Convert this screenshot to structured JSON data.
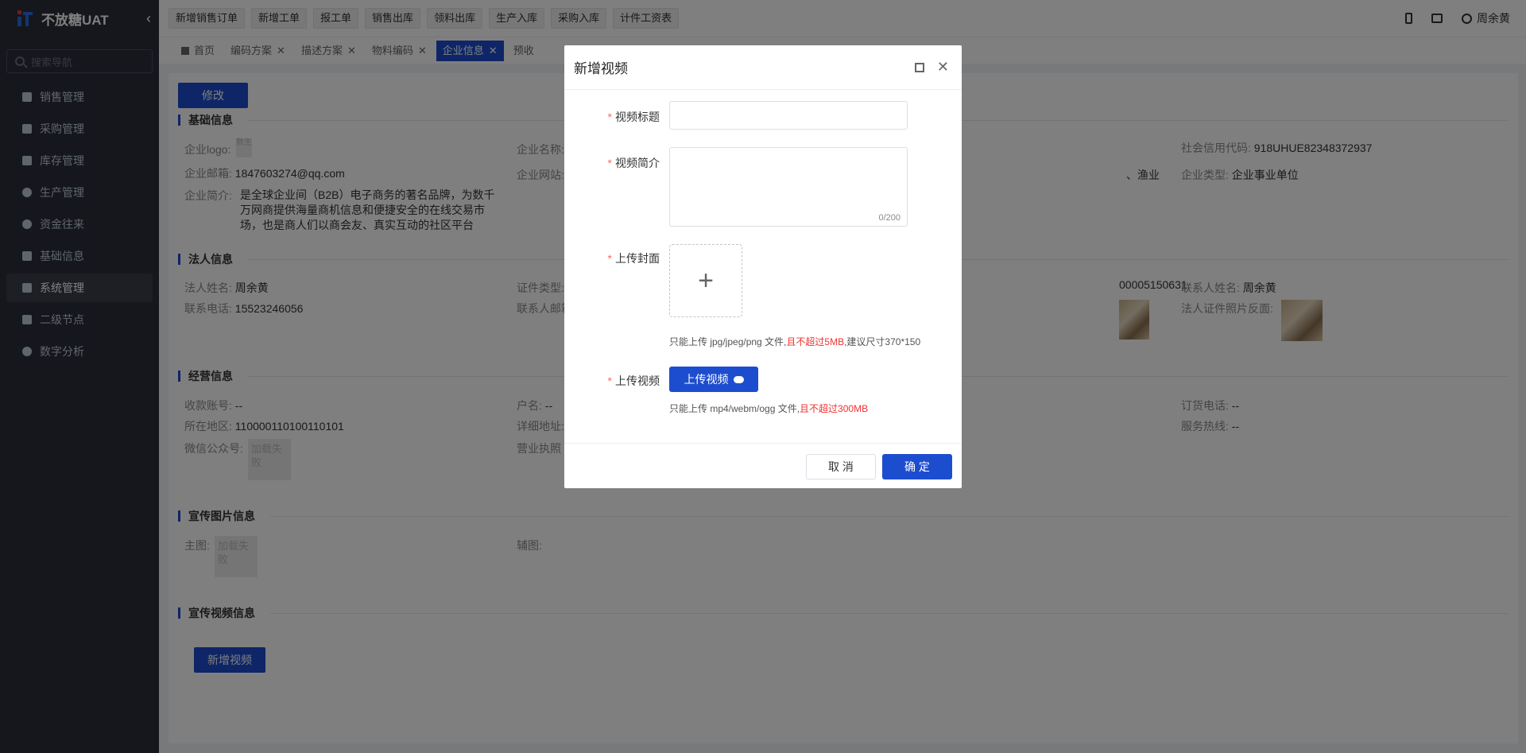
{
  "app": {
    "title": "不放糖UAT"
  },
  "sidebar": {
    "search_placeholder": "搜索导航",
    "items": [
      {
        "label": "销售管理",
        "icon": "tag-icon"
      },
      {
        "label": "采购管理",
        "icon": "cart-icon"
      },
      {
        "label": "库存管理",
        "icon": "box-icon"
      },
      {
        "label": "生产管理",
        "icon": "factory-icon"
      },
      {
        "label": "资金往来",
        "icon": "money-icon"
      },
      {
        "label": "基础信息",
        "icon": "info-icon"
      },
      {
        "label": "系统管理",
        "icon": "grid-icon"
      },
      {
        "label": "二级节点",
        "icon": "doc-icon"
      },
      {
        "label": "数字分析",
        "icon": "pie-icon"
      }
    ]
  },
  "topbar": {
    "quick_buttons": [
      "新增销售订单",
      "新增工单",
      "报工单",
      "销售出库",
      "领料出库",
      "生产入库",
      "采购入库",
      "计件工资表"
    ],
    "user": "周余黄"
  },
  "tabs": [
    {
      "label": "首页"
    },
    {
      "label": "编码方案"
    },
    {
      "label": "描述方案"
    },
    {
      "label": "物料编码"
    },
    {
      "label": "企业信息"
    },
    {
      "label": "预收"
    }
  ],
  "page": {
    "edit_button": "修改",
    "sections": {
      "basic": "基础信息",
      "legal": "法人信息",
      "business": "经营信息",
      "promo_images": "宣传图片信息",
      "promo_videos": "宣传视频信息"
    },
    "basic": {
      "logo_label": "企业logo:",
      "logo_thumb": "数生",
      "name_label": "企业名称:",
      "credit_label": "社会信用代码:",
      "credit_value": "918UHUE82348372937",
      "email_label": "企业邮箱:",
      "email_value": "1847603274@qq.com",
      "site_label": "企业网站:",
      "industry_tail": "、渔业",
      "type_label": "企业类型:",
      "type_value": "企业事业单位",
      "intro_label": "企业简介:",
      "intro_value": "是全球企业间（B2B）电子商务的著名品牌，为数千万网商提供海量商机信息和便捷安全的在线交易市场，也是商人们以商会友、真实互动的社区平台"
    },
    "legal": {
      "name_label": "法人姓名:",
      "name_value": "周余黄",
      "cert_type_label": "证件类型:",
      "cert_no_tail": "00005150631",
      "contact_name_label": "联系人姓名:",
      "contact_name_value": "周余黄",
      "phone_label": "联系电话:",
      "phone_value": "15523246056",
      "contact_email_label": "联系人邮箱",
      "back_photo_label": "法人证件照片反面:"
    },
    "business": {
      "account_label": "收款账号:",
      "account_value": "--",
      "holder_label": "户名:",
      "holder_value": "--",
      "order_phone_label": "订货电话:",
      "order_phone_value": "--",
      "region_label": "所在地区:",
      "region_value": "110000110100110101",
      "address_label": "详细地址:",
      "hotline_label": "服务热线:",
      "hotline_value": "--",
      "wechat_label": "微信公众号:",
      "wechat_thumb": "加载失败",
      "license_label": "营业执照"
    },
    "promo": {
      "main_label": "主图:",
      "main_thumb": "加载失败",
      "sub_label": "辅图:"
    },
    "add_video_button": "新增视频"
  },
  "dialog": {
    "title": "新增视频",
    "video_title_label": "视频标题",
    "video_title_value": "",
    "intro_label": "视频简介",
    "intro_value": "",
    "intro_counter": "0/200",
    "cover_label": "上传封面",
    "cover_hint_prefix": "只能上传 jpg/jpeg/png 文件,",
    "cover_hint_red": "且不超过5MB",
    "cover_hint_suffix": ",建议尺寸370*150",
    "video_label": "上传视频",
    "upload_button": "上传视频",
    "video_hint_prefix": "只能上传 mp4/webm/ogg 文件,",
    "video_hint_red": "且不超过300MB",
    "cancel": "取 消",
    "confirm": "确 定"
  },
  "colors": {
    "primary": "#1d4dcf",
    "sidebar_bg": "#2b2f3a",
    "required": "#f56c6c",
    "warning_text": "#f23030"
  }
}
